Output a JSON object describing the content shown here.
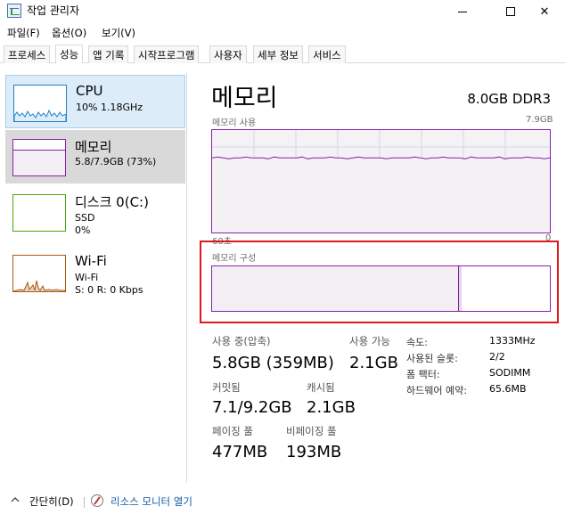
{
  "window": {
    "title": "작업 관리자"
  },
  "menu": [
    "파일(F)",
    "옵션(O)",
    "보기(V)"
  ],
  "tabs": [
    "프로세스",
    "성능",
    "앱 기록",
    "시작프로그램",
    "사용자",
    "세부 정보",
    "서비스"
  ],
  "active_tab": "성능",
  "sidebar": {
    "cpu": {
      "title": "CPU",
      "sub": "10% 1.18GHz"
    },
    "memory": {
      "title": "메모리",
      "sub": "5.8/7.9GB (73%)"
    },
    "disk": {
      "title": "디스크 0(C:)",
      "sub1": "SSD",
      "sub2": "0%"
    },
    "wifi": {
      "title": "Wi-Fi",
      "sub1": "Wi-Fi",
      "sub2": "S: 0  R: 0 Kbps"
    }
  },
  "main": {
    "title": "메모리",
    "spec": "8.0GB DDR3",
    "usage_label": "메모리 사용",
    "usage_max": "7.9GB",
    "x_left": "60초",
    "x_right": "0",
    "composition_label": "메모리 구성",
    "usage_level_pct": 73
  },
  "stats": {
    "in_use_label": "사용 중(압축)",
    "in_use_value": "5.8GB (359MB)",
    "available_label": "사용 가능",
    "available_value": "2.1GB",
    "committed_label": "커밋됨",
    "committed_value": "7.1/9.2GB",
    "cached_label": "캐시됨",
    "cached_value": "2.1GB",
    "paged_label": "페이징 풀",
    "paged_value": "477MB",
    "nonpaged_label": "비페이징 풀",
    "nonpaged_value": "193MB"
  },
  "specs": [
    {
      "key": "속도:",
      "value": "1333MHz"
    },
    {
      "key": "사용된 슬롯:",
      "value": "2/2"
    },
    {
      "key": "폼 팩터:",
      "value": "SODIMM"
    },
    {
      "key": "하드웨어 예약:",
      "value": "65.6MB"
    }
  ],
  "footer": {
    "collapse_label": "간단히(D)",
    "resource_monitor_label": "리소스 모니터 열기"
  },
  "colors": {
    "memory_accent": "#8b1fa9",
    "cpu_accent": "#1e81c7",
    "disk_accent": "#4da60c",
    "wifi_accent": "#a75a14",
    "highlight": "#e0171c"
  }
}
